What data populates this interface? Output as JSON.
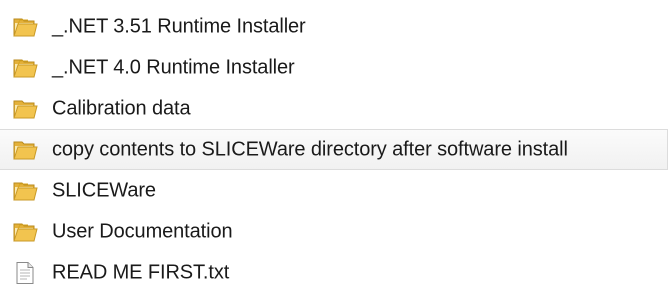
{
  "explorer": {
    "items": [
      {
        "name": "_.NET 3.51 Runtime Installer",
        "type": "folder",
        "icon": "folder-icon"
      },
      {
        "name": "_.NET 4.0 Runtime Installer",
        "type": "folder",
        "icon": "folder-icon"
      },
      {
        "name": "Calibration data",
        "type": "folder",
        "icon": "folder-icon"
      },
      {
        "name": "copy contents to SLICEWare directory after software install",
        "type": "folder",
        "icon": "folder-icon",
        "hovered": true
      },
      {
        "name": "SLICEWare",
        "type": "folder",
        "icon": "folder-icon"
      },
      {
        "name": "User Documentation",
        "type": "folder",
        "icon": "folder-icon"
      },
      {
        "name": "READ ME FIRST.txt",
        "type": "text-file",
        "icon": "text-file-icon"
      }
    ]
  },
  "colors": {
    "folder_body": "#f2c44f",
    "folder_shadow": "#d9a520",
    "folder_edge": "#b98a1c",
    "hover_border": "#dcdcdc",
    "text": "#1a1a1a"
  }
}
